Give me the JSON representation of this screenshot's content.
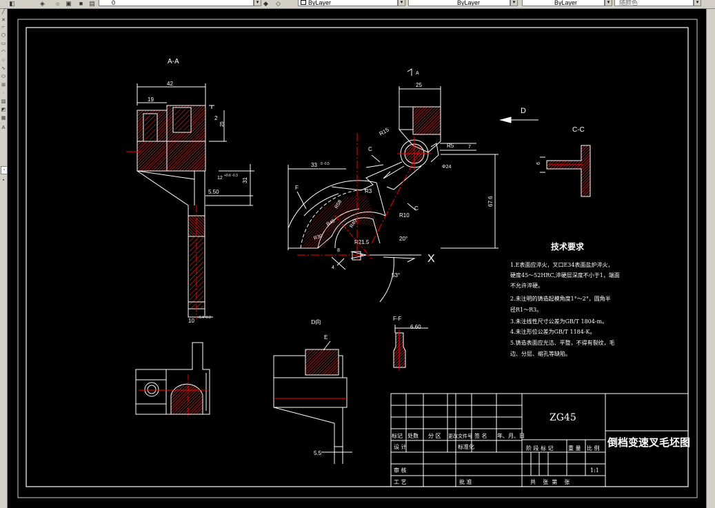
{
  "toolbar": {
    "combo_1": "",
    "layer_combo": "ByLayer",
    "linetype_combo": "ByLayer",
    "lineweight_combo": "ByLayer",
    "color_combo": "随颜色",
    "layer_number": "0"
  },
  "drawing": {
    "section_aa": "A-A",
    "section_cc": "C-C",
    "view_d_label": "D向",
    "section_ff": "F-F",
    "arrow_d": "D",
    "arrow_a": "A",
    "label_e": "E",
    "label_c1": "C",
    "label_c2": "C",
    "label_f": "F",
    "label_x": "X",
    "dims": {
      "d_42": "42",
      "d_19": "19",
      "d_2": "2",
      "d_25_aa": "25",
      "d_12": "12",
      "d_12_tol": "+0.6 -0.3",
      "d_31": "31",
      "d_550": "5.50",
      "d_10": "10",
      "d_10_tol": "+0.4 -0.2",
      "d_25_top": "25",
      "d_r15": "R15",
      "d_r5": "R5",
      "d_7": "7",
      "d_phi24": "Φ24",
      "d_33": "33",
      "d_33_tol": "0 -0.5",
      "d_r3": "R3",
      "d_676": "67.6",
      "d_r10": "R10",
      "d_20deg": "20°",
      "d_53deg": "53°",
      "d_r215": "R21.5",
      "d_r58": "R58",
      "d_r40": "R40",
      "d_r45": "R45",
      "d_r30": "R30",
      "d_4": "4",
      "d_8": "8",
      "d_6_cc": "6",
      "d_660": "6.60",
      "d_55": "5.5"
    },
    "tech": {
      "title": "技术要求",
      "line1": "1.E表面应淬火，叉口E34表面盐炉淬火，",
      "line2": "硬度45～52HRC,淬硬层深度不小于1，端面",
      "line3": "不允许淬硬。",
      "line4": "2.未注明的铸造起模角度1°～2°，圆角半",
      "line5": "径R1～R3。",
      "line6": "3.未注线性尺寸公差为GB/T 1804-m。",
      "line7": "4.未注形位公差为GB/T 1184-K。",
      "line8": "5.铸造表面应光洁、平整，不得有裂纹，毛",
      "line9": "边、分层、缩孔等缺陷。"
    }
  },
  "title_block": {
    "material": "ZG45",
    "part_name": "倒档变速叉毛坯图",
    "h_mark": "标记",
    "h_count": "处数",
    "h_zone": "分 区",
    "h_doc": "更改文件号",
    "h_sign": "签 名",
    "h_date": "年、月、日",
    "design": "设 计",
    "standard": "标准化",
    "stage": "阶 段 标 记",
    "weight": "重 量",
    "scale": "比 例",
    "scale_val": "1:1",
    "review": "审 核",
    "process": "工 艺",
    "approve": "批 准",
    "sheets": "共    张  第    张"
  },
  "colors": {
    "canvas": "#000000",
    "lines": "#ffffff",
    "hatch": "#ff3333",
    "center": "#ff0000",
    "toolbar": "#d4d0c8"
  }
}
